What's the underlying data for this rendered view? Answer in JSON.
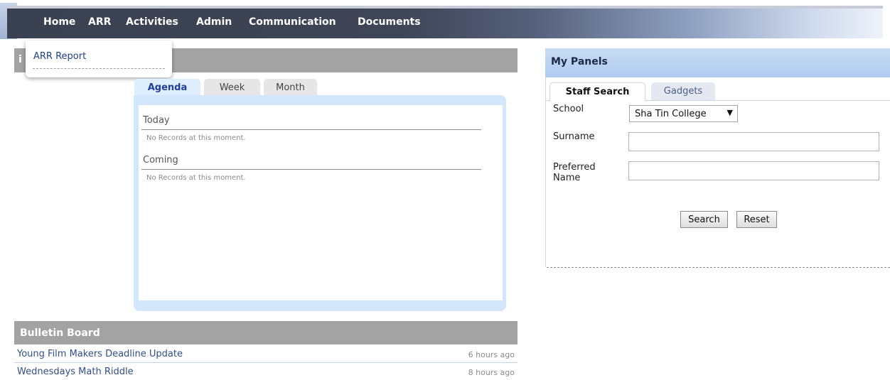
{
  "nav": {
    "items": [
      "Home",
      "ARR",
      "Activities",
      "Admin",
      "Communication",
      "Documents"
    ]
  },
  "arr_menu": {
    "items": [
      "ARR Report"
    ]
  },
  "left_header_stub": "i",
  "calendar": {
    "tabs": [
      "Agenda",
      "Week",
      "Month"
    ],
    "active_tab": "Agenda",
    "sections": [
      {
        "title": "Today",
        "empty_text": "No Records at this moment."
      },
      {
        "title": "Coming",
        "empty_text": "No Records at this moment."
      }
    ]
  },
  "bulletin": {
    "title": "Bulletin Board",
    "items": [
      {
        "title": "Young Film Makers Deadline Update",
        "time": "6 hours ago"
      },
      {
        "title": "Wednesdays Math Riddle",
        "time": "8 hours ago"
      }
    ]
  },
  "my_panels": {
    "title": "My Panels",
    "tabs": [
      "Staff Search",
      "Gadgets"
    ],
    "active_tab": "Staff Search",
    "form": {
      "school_label": "School",
      "school_value": "Sha Tin College",
      "surname_label": "Surname",
      "surname_value": "",
      "preferred_label_line1": "Preferred",
      "preferred_label_line2": "Name",
      "preferred_value": "",
      "search_button": "Search",
      "reset_button": "Reset"
    }
  },
  "colors": {
    "nav_dark": "#3a4150",
    "link": "#2f4f8f",
    "grey_header": "#a3a3a3",
    "panel_header": "#b7d0f0"
  }
}
